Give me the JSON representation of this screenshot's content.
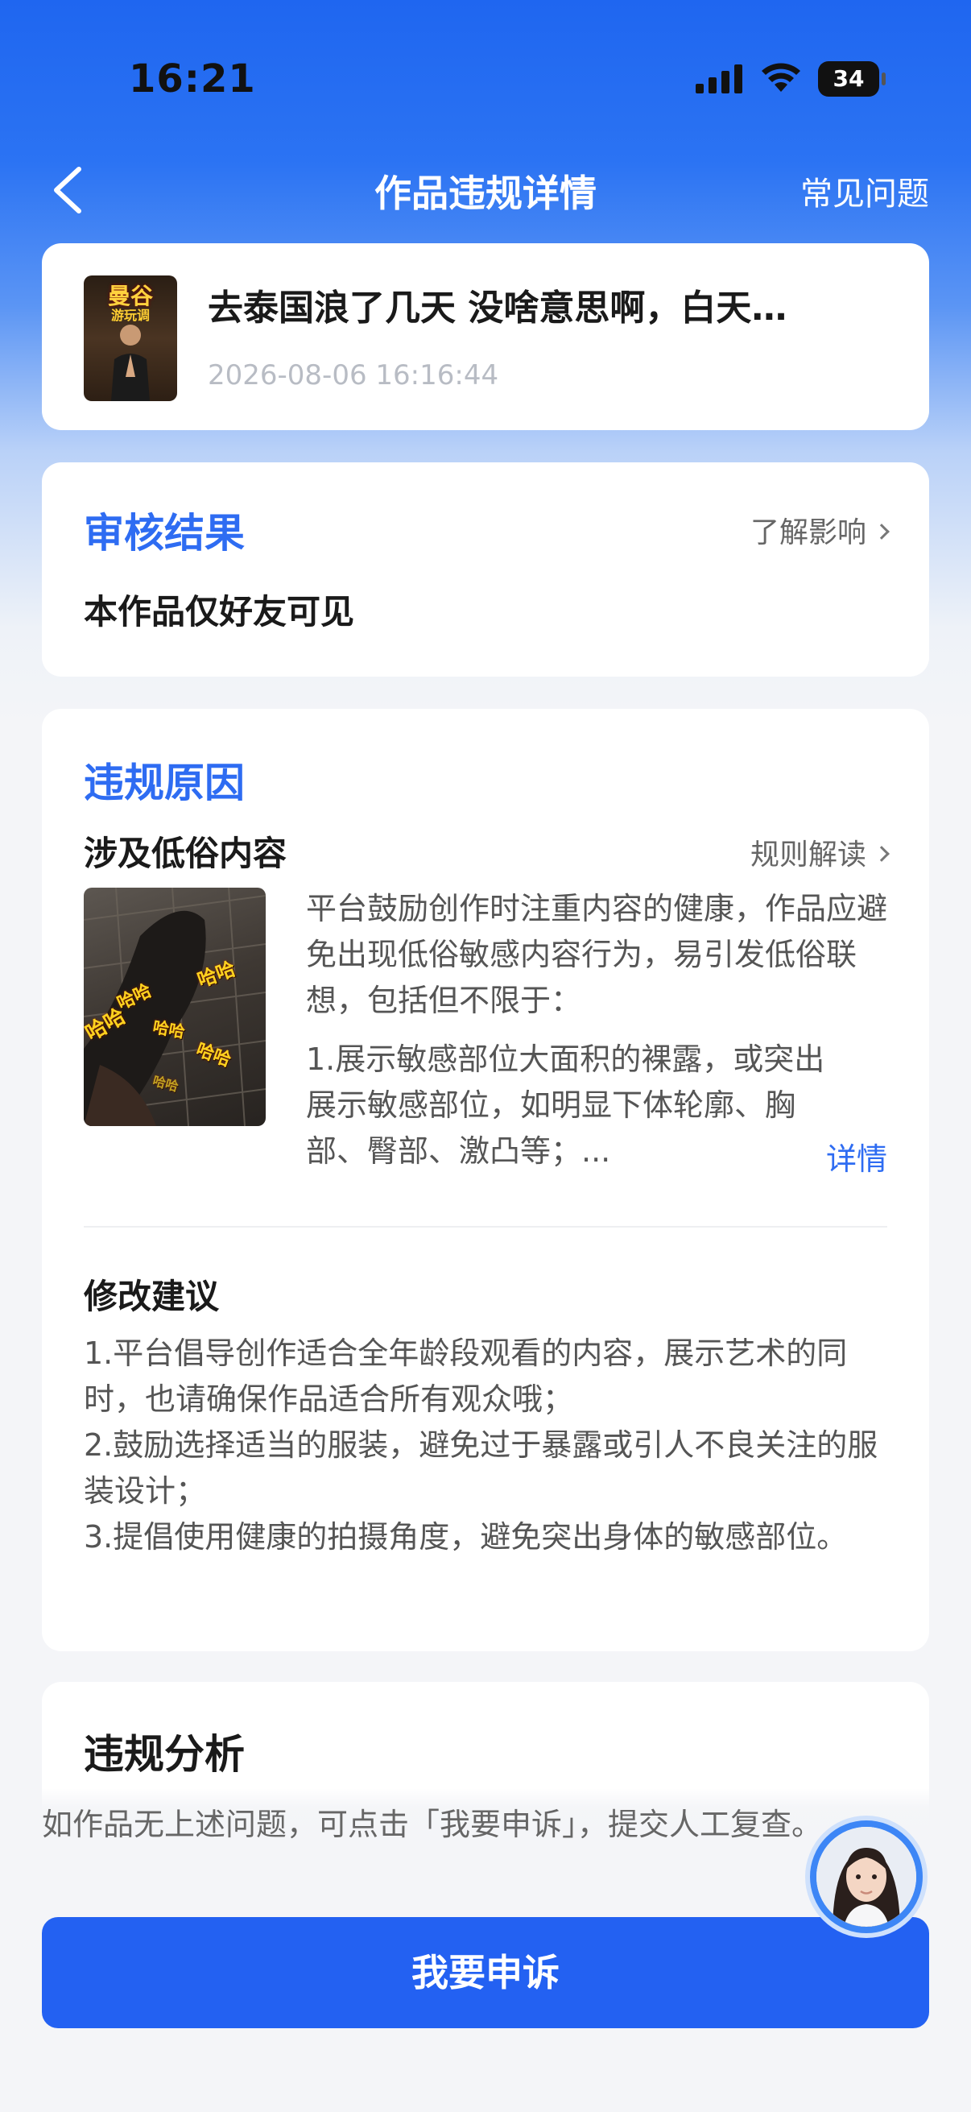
{
  "status_bar": {
    "time": "16:21",
    "battery": "34"
  },
  "nav": {
    "title": "作品违规详情",
    "faq": "常见问题"
  },
  "work": {
    "title": "去泰国浪了几天 没啥意思啊，白天…",
    "time": "2026-08-06 16:16:44",
    "thumb_text": "曼谷",
    "thumb_sub": "游玩调"
  },
  "review": {
    "title": "审核结果",
    "link": "了解影响",
    "result": "本作品仅好友可见"
  },
  "violation": {
    "title": "违规原因",
    "type": "涉及低俗内容",
    "rule_link": "规则解读",
    "thumb_labels": [
      "哈哈",
      "哈哈",
      "哈哈",
      "哈哈",
      "哈哈",
      "哈哈"
    ],
    "desc": [
      "平台鼓励创作时注重内容的健康，作品应避免出现低俗敏感内容行为，易引发低俗联想，包括但不限于：",
      "1.展示敏感部位大面积的裸露，或突出展示敏感部位，如明显下体轮廓、胸部、臀部、激凸等；..."
    ],
    "detail_link": "详情"
  },
  "suggestion": {
    "title": "修改建议",
    "items": [
      "1.平台倡导创作适合全年龄段观看的内容，展示艺术的同时，也请确保作品适合所有观众哦；",
      "2.鼓励选择适当的服装，避免过于暴露或引人不良关注的服装设计；",
      "3.提倡使用健康的拍摄角度，避免突出身体的敏感部位。"
    ]
  },
  "analysis": {
    "title": "违规分析"
  },
  "appeal": {
    "hint": "如作品无上述问题，可点击「我要申诉」，提交人工复查。",
    "button": "我要申诉"
  }
}
